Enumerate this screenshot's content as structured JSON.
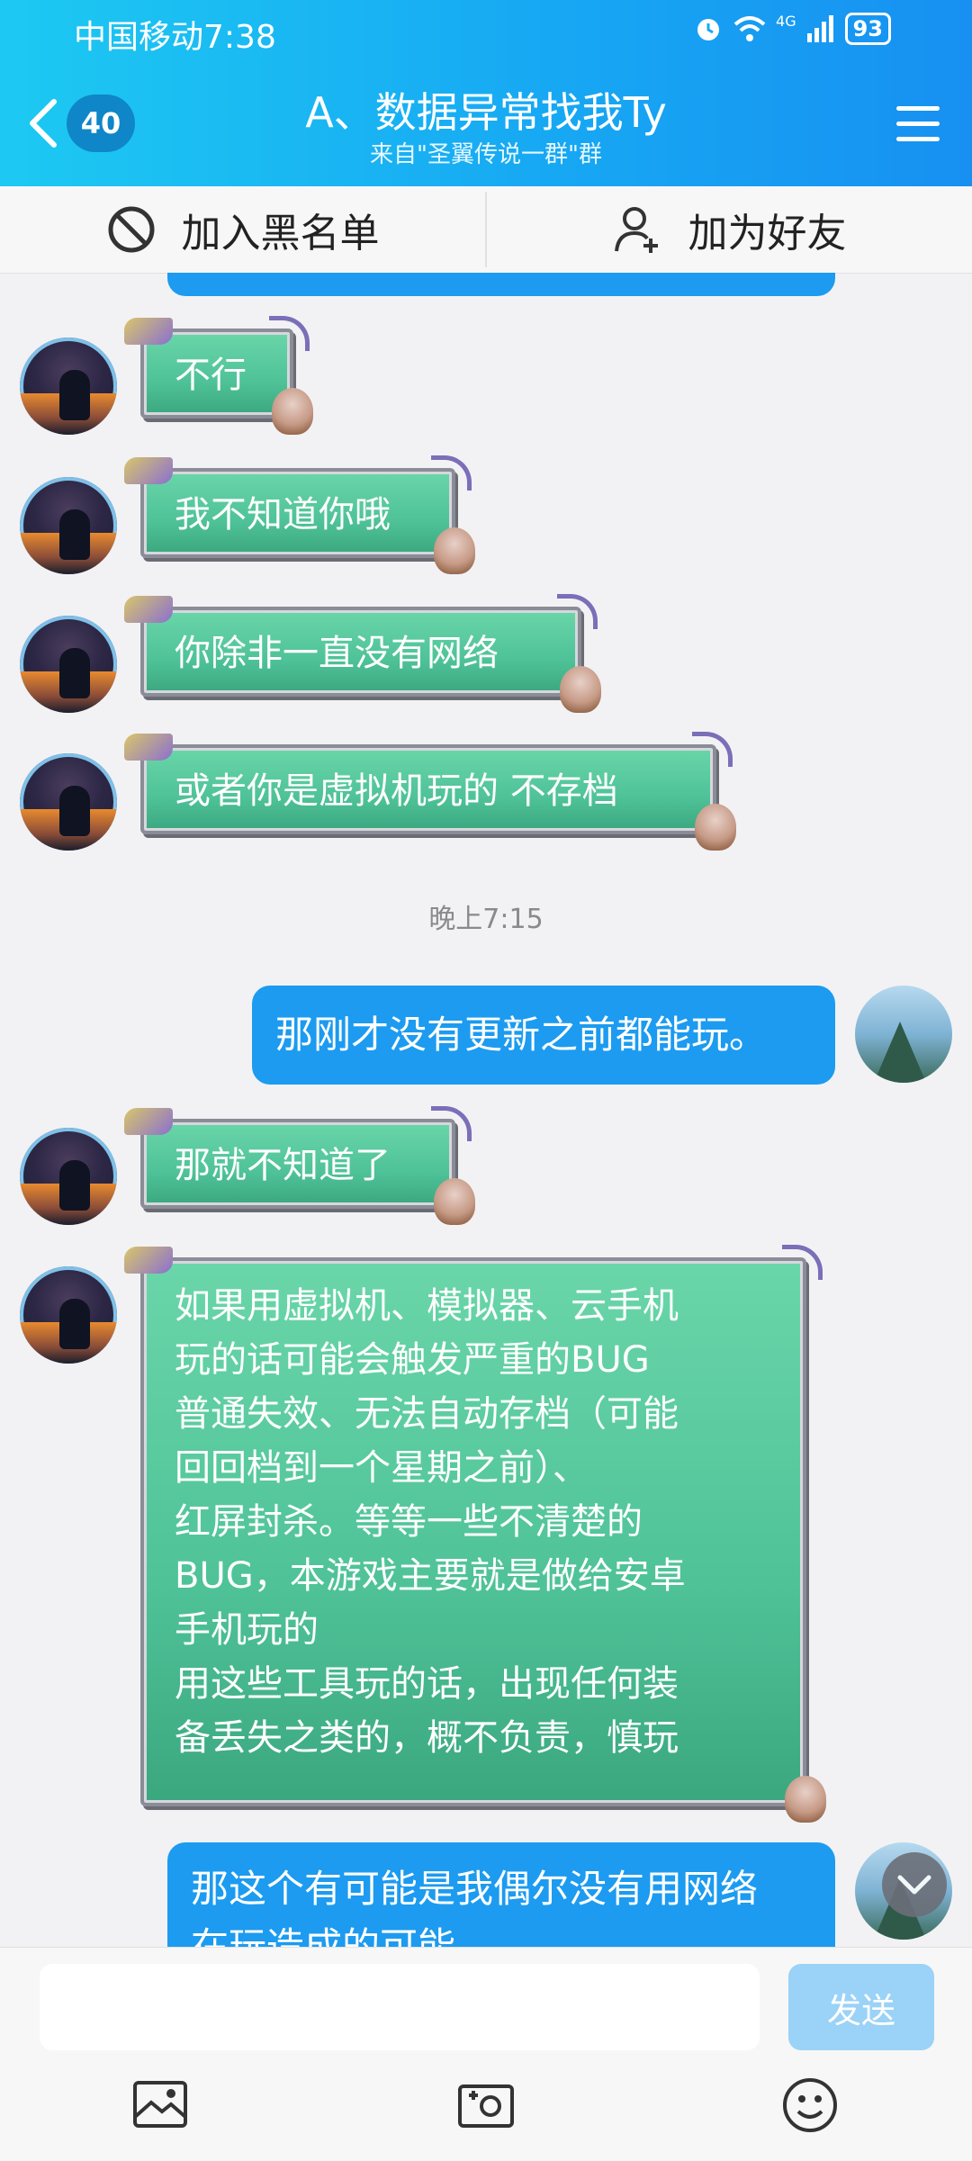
{
  "status_bar": {
    "carrier": "中国移动",
    "time": "7:38",
    "network": "4G",
    "battery": "93"
  },
  "header": {
    "unread_count": "40",
    "title": "A、数据异常找我Ty",
    "subtitle": "来自\"圣翼传说一群\"群"
  },
  "actions": {
    "block_label": "加入黑名单",
    "add_friend_label": "加为好友"
  },
  "messages": [
    {
      "side": "left",
      "text": "不行"
    },
    {
      "side": "left",
      "text": "我不知道你哦"
    },
    {
      "side": "left",
      "text": "你除非一直没有网络"
    },
    {
      "side": "left",
      "text": "或者你是虚拟机玩的 不存档"
    },
    {
      "type": "timestamp",
      "text": "晚上7:15"
    },
    {
      "side": "right",
      "text": "那刚才没有更新之前都能玩。"
    },
    {
      "side": "left",
      "text": "那就不知道了"
    },
    {
      "side": "left",
      "lines": [
        "如果用虚拟机、模拟器、云手机",
        "玩的话可能会触发严重的BUG",
        "普通失效、无法自动存档（可能",
        "回回档到一个星期之前）、",
        "红屏封杀。等等一些不清楚的",
        "BUG，本游戏主要就是做给安卓",
        "手机玩的",
        "用这些工具玩的话，出现任何装",
        "备丢失之类的，概不负责，慎玩"
      ]
    },
    {
      "side": "right",
      "lines": [
        "那这个有可能是我偶尔没有用网络",
        "在玩造成的可能"
      ]
    }
  ],
  "input": {
    "value": "",
    "send_label": "发送"
  }
}
